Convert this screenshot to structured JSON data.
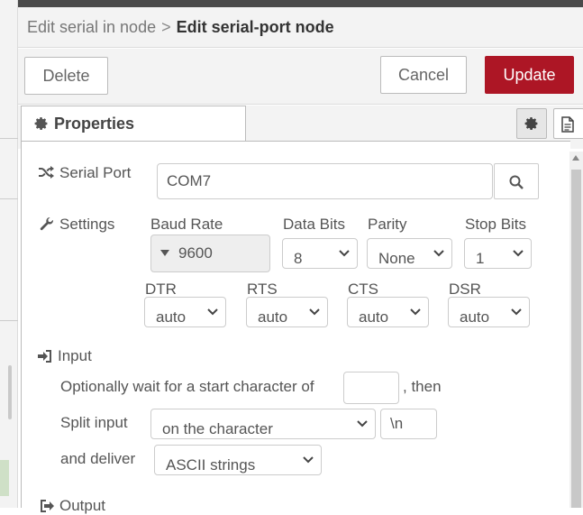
{
  "breadcrumb": {
    "parent": "Edit serial in node",
    "separator": ">",
    "current": "Edit serial-port node"
  },
  "toolbar": {
    "delete_label": "Delete",
    "cancel_label": "Cancel",
    "update_label": "Update",
    "update_color": "#ad1625"
  },
  "tabs": {
    "properties_label": "Properties"
  },
  "form": {
    "serial_port_label": "Serial Port",
    "serial_port_value": "COM7",
    "settings_label": "Settings",
    "baud_rate_label": "Baud Rate",
    "baud_rate_value": "9600",
    "data_bits_label": "Data Bits",
    "data_bits_value": "8",
    "parity_label": "Parity",
    "parity_value": "None",
    "stop_bits_label": "Stop Bits",
    "stop_bits_value": "1",
    "dtr_label": "DTR",
    "dtr_value": "auto",
    "rts_label": "RTS",
    "rts_value": "auto",
    "cts_label": "CTS",
    "cts_value": "auto",
    "dsr_label": "DSR",
    "dsr_value": "auto",
    "input_label": "Input",
    "wait_text": "Optionally wait for a start character of",
    "wait_value": "",
    "then_text": ", then",
    "split_label": "Split input",
    "split_value": "on the character",
    "split_char_value": "\\n",
    "deliver_label": "and deliver",
    "deliver_value": "ASCII strings",
    "output_label": "Output"
  }
}
